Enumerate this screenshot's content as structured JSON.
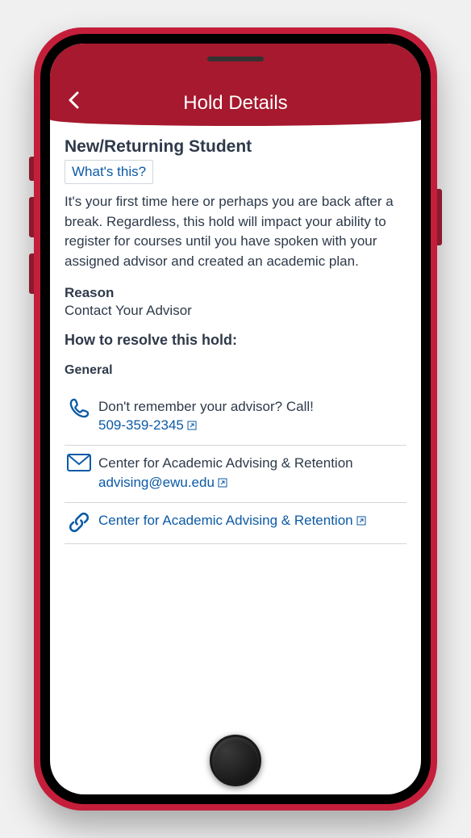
{
  "header": {
    "title": "Hold Details"
  },
  "hold": {
    "title": "New/Returning Student",
    "whats_this": "What's this?",
    "description": "It's your first time here or perhaps you are back after a break. Regardless, this hold will impact your ability to register for courses until you have spoken with your assigned advisor and created an academic plan.",
    "reason_label": "Reason",
    "reason_value": "Contact Your Advisor",
    "resolve_heading": "How to resolve this hold:",
    "subsection": "General"
  },
  "contacts": {
    "phone": {
      "label": "Don't remember your advisor? Call!",
      "value": "509-359-2345"
    },
    "email": {
      "label": "Center for Academic Advising & Retention",
      "value": "advising@ewu.edu"
    },
    "link": {
      "value": "Center for Academic Advising & Retention"
    }
  },
  "colors": {
    "brand": "#a6192e",
    "link": "#0c5aa6",
    "text": "#2e3a4a"
  }
}
